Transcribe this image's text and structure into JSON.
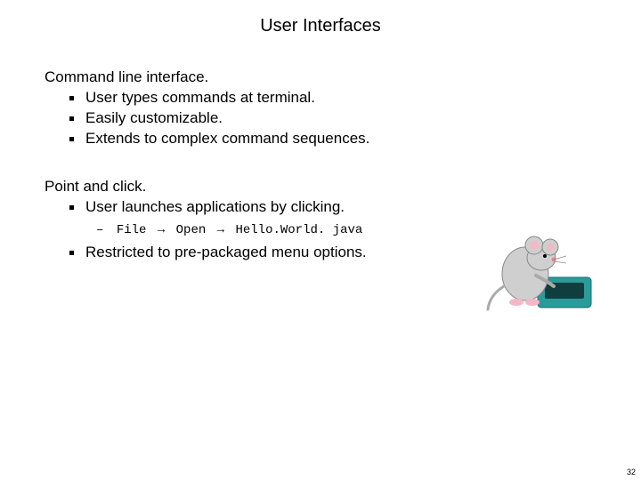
{
  "title": "User Interfaces",
  "sections": {
    "cli": {
      "heading": "Command line interface.",
      "items": [
        "User types commands at terminal.",
        "Easily customizable.",
        "Extends to complex command sequences."
      ]
    },
    "pac": {
      "heading": "Point and click.",
      "item0": "User launches applications by clicking.",
      "example": {
        "part1": "File",
        "part2": "Open",
        "part3": "Hello.World. java"
      },
      "item1": "Restricted to pre-packaged menu options."
    }
  },
  "page_number": "32",
  "arrow": "→",
  "image_alt": "mouse-with-computer-mouse"
}
